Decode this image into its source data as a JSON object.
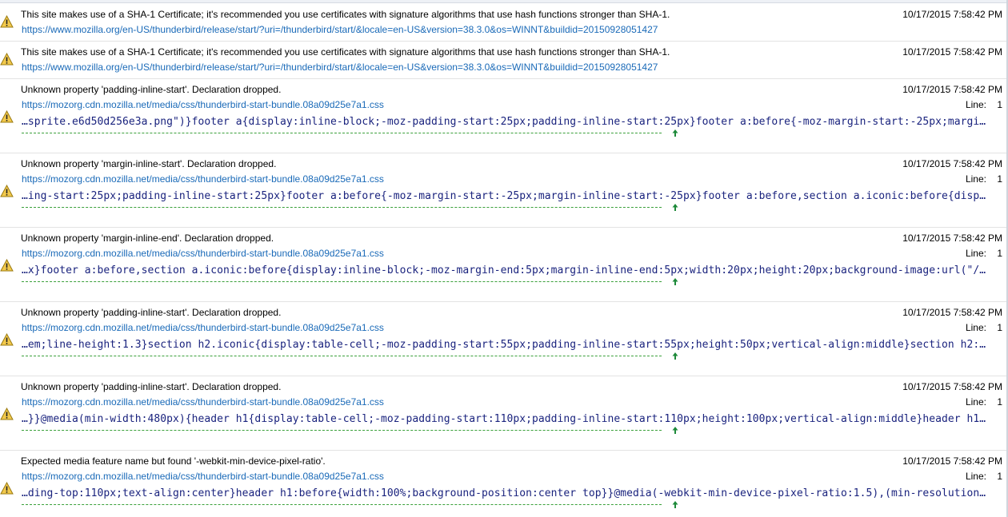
{
  "colors": {
    "link": "#1a6ab8",
    "code_text": "#1a237e",
    "underline": "#3aa03a",
    "warning": "#f2c94c"
  },
  "entries": [
    {
      "kind": "short",
      "icon": "warning-icon",
      "message": "This site makes use of a SHA-1 Certificate; it's recommended you use certificates with signature algorithms that use hash functions stronger than SHA-1.",
      "url": "https://www.mozilla.org/en-US/thunderbird/release/start/?uri=/thunderbird/start/&locale=en-US&version=38.3.0&os=WINNT&buildid=20150928051427",
      "timestamp": "10/17/2015 7:58:42 PM"
    },
    {
      "kind": "short",
      "icon": "warning-icon",
      "message": "This site makes use of a SHA-1 Certificate; it's recommended you use certificates with signature algorithms that use hash functions stronger than SHA-1.",
      "url": "https://www.mozilla.org/en-US/thunderbird/release/start/?uri=/thunderbird/start/&locale=en-US&version=38.3.0&os=WINNT&buildid=20150928051427",
      "timestamp": "10/17/2015 7:58:42 PM"
    },
    {
      "kind": "tall",
      "icon": "warning-icon",
      "message": "Unknown property 'padding-inline-start'.  Declaration dropped.",
      "url": "https://mozorg.cdn.mozilla.net/media/css/thunderbird-start-bundle.08a09d25e7a1.css",
      "timestamp": "10/17/2015 7:58:42 PM",
      "line_label": "Line:",
      "line_number": "1",
      "code": "…sprite.e6d50d256e3a.png\")}footer a{display:inline-block;-moz-padding-start:25px;padding-inline-start:25px}footer a:before{-moz-margin-start:-25px;margi…"
    },
    {
      "kind": "tall",
      "icon": "warning-icon",
      "message": "Unknown property 'margin-inline-start'.  Declaration dropped.",
      "url": "https://mozorg.cdn.mozilla.net/media/css/thunderbird-start-bundle.08a09d25e7a1.css",
      "timestamp": "10/17/2015 7:58:42 PM",
      "line_label": "Line:",
      "line_number": "1",
      "code": "…ing-start:25px;padding-inline-start:25px}footer a:before{-moz-margin-start:-25px;margin-inline-start:-25px}footer a:before,section a.iconic:before{disp…"
    },
    {
      "kind": "tall",
      "icon": "warning-icon",
      "message": "Unknown property 'margin-inline-end'.  Declaration dropped.",
      "url": "https://mozorg.cdn.mozilla.net/media/css/thunderbird-start-bundle.08a09d25e7a1.css",
      "timestamp": "10/17/2015 7:58:42 PM",
      "line_label": "Line:",
      "line_number": "1",
      "code": "…x}footer a:before,section a.iconic:before{display:inline-block;-moz-margin-end:5px;margin-inline-end:5px;width:20px;height:20px;background-image:url(\"/…"
    },
    {
      "kind": "tall",
      "icon": "warning-icon",
      "message": "Unknown property 'padding-inline-start'.  Declaration dropped.",
      "url": "https://mozorg.cdn.mozilla.net/media/css/thunderbird-start-bundle.08a09d25e7a1.css",
      "timestamp": "10/17/2015 7:58:42 PM",
      "line_label": "Line:",
      "line_number": "1",
      "code": "…em;line-height:1.3}section h2.iconic{display:table-cell;-moz-padding-start:55px;padding-inline-start:55px;height:50px;vertical-align:middle}section h2:…"
    },
    {
      "kind": "tall",
      "icon": "warning-icon",
      "message": "Unknown property 'padding-inline-start'.  Declaration dropped.",
      "url": "https://mozorg.cdn.mozilla.net/media/css/thunderbird-start-bundle.08a09d25e7a1.css",
      "timestamp": "10/17/2015 7:58:42 PM",
      "line_label": "Line:",
      "line_number": "1",
      "code": "…}}@media(min-width:480px){header h1{display:table-cell;-moz-padding-start:110px;padding-inline-start:110px;height:100px;vertical-align:middle}header h1…"
    },
    {
      "kind": "last",
      "icon": "warning-icon",
      "message": "Expected media feature name but found '-webkit-min-device-pixel-ratio'.",
      "url": "https://mozorg.cdn.mozilla.net/media/css/thunderbird-start-bundle.08a09d25e7a1.css",
      "timestamp": "10/17/2015 7:58:42 PM",
      "line_label": "Line:",
      "line_number": "1",
      "code": "…ding-top:110px;text-align:center}header h1:before{width:100%;background-position:center top}}@media(-webkit-min-device-pixel-ratio:1.5),(min-resolution…"
    }
  ]
}
